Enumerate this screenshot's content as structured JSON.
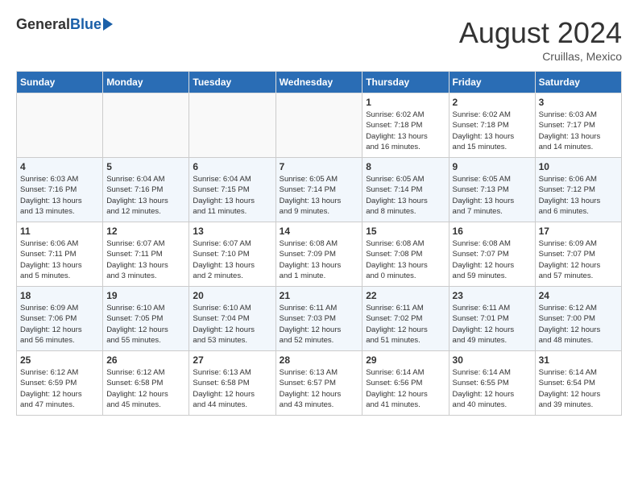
{
  "header": {
    "logo_general": "General",
    "logo_blue": "Blue",
    "month_year": "August 2024",
    "location": "Cruillas, Mexico"
  },
  "days_of_week": [
    "Sunday",
    "Monday",
    "Tuesday",
    "Wednesday",
    "Thursday",
    "Friday",
    "Saturday"
  ],
  "weeks": [
    [
      {
        "day": "",
        "info": ""
      },
      {
        "day": "",
        "info": ""
      },
      {
        "day": "",
        "info": ""
      },
      {
        "day": "",
        "info": ""
      },
      {
        "day": "1",
        "info": "Sunrise: 6:02 AM\nSunset: 7:18 PM\nDaylight: 13 hours\nand 16 minutes."
      },
      {
        "day": "2",
        "info": "Sunrise: 6:02 AM\nSunset: 7:18 PM\nDaylight: 13 hours\nand 15 minutes."
      },
      {
        "day": "3",
        "info": "Sunrise: 6:03 AM\nSunset: 7:17 PM\nDaylight: 13 hours\nand 14 minutes."
      }
    ],
    [
      {
        "day": "4",
        "info": "Sunrise: 6:03 AM\nSunset: 7:16 PM\nDaylight: 13 hours\nand 13 minutes."
      },
      {
        "day": "5",
        "info": "Sunrise: 6:04 AM\nSunset: 7:16 PM\nDaylight: 13 hours\nand 12 minutes."
      },
      {
        "day": "6",
        "info": "Sunrise: 6:04 AM\nSunset: 7:15 PM\nDaylight: 13 hours\nand 11 minutes."
      },
      {
        "day": "7",
        "info": "Sunrise: 6:05 AM\nSunset: 7:14 PM\nDaylight: 13 hours\nand 9 minutes."
      },
      {
        "day": "8",
        "info": "Sunrise: 6:05 AM\nSunset: 7:14 PM\nDaylight: 13 hours\nand 8 minutes."
      },
      {
        "day": "9",
        "info": "Sunrise: 6:05 AM\nSunset: 7:13 PM\nDaylight: 13 hours\nand 7 minutes."
      },
      {
        "day": "10",
        "info": "Sunrise: 6:06 AM\nSunset: 7:12 PM\nDaylight: 13 hours\nand 6 minutes."
      }
    ],
    [
      {
        "day": "11",
        "info": "Sunrise: 6:06 AM\nSunset: 7:11 PM\nDaylight: 13 hours\nand 5 minutes."
      },
      {
        "day": "12",
        "info": "Sunrise: 6:07 AM\nSunset: 7:11 PM\nDaylight: 13 hours\nand 3 minutes."
      },
      {
        "day": "13",
        "info": "Sunrise: 6:07 AM\nSunset: 7:10 PM\nDaylight: 13 hours\nand 2 minutes."
      },
      {
        "day": "14",
        "info": "Sunrise: 6:08 AM\nSunset: 7:09 PM\nDaylight: 13 hours\nand 1 minute."
      },
      {
        "day": "15",
        "info": "Sunrise: 6:08 AM\nSunset: 7:08 PM\nDaylight: 13 hours\nand 0 minutes."
      },
      {
        "day": "16",
        "info": "Sunrise: 6:08 AM\nSunset: 7:07 PM\nDaylight: 12 hours\nand 59 minutes."
      },
      {
        "day": "17",
        "info": "Sunrise: 6:09 AM\nSunset: 7:07 PM\nDaylight: 12 hours\nand 57 minutes."
      }
    ],
    [
      {
        "day": "18",
        "info": "Sunrise: 6:09 AM\nSunset: 7:06 PM\nDaylight: 12 hours\nand 56 minutes."
      },
      {
        "day": "19",
        "info": "Sunrise: 6:10 AM\nSunset: 7:05 PM\nDaylight: 12 hours\nand 55 minutes."
      },
      {
        "day": "20",
        "info": "Sunrise: 6:10 AM\nSunset: 7:04 PM\nDaylight: 12 hours\nand 53 minutes."
      },
      {
        "day": "21",
        "info": "Sunrise: 6:11 AM\nSunset: 7:03 PM\nDaylight: 12 hours\nand 52 minutes."
      },
      {
        "day": "22",
        "info": "Sunrise: 6:11 AM\nSunset: 7:02 PM\nDaylight: 12 hours\nand 51 minutes."
      },
      {
        "day": "23",
        "info": "Sunrise: 6:11 AM\nSunset: 7:01 PM\nDaylight: 12 hours\nand 49 minutes."
      },
      {
        "day": "24",
        "info": "Sunrise: 6:12 AM\nSunset: 7:00 PM\nDaylight: 12 hours\nand 48 minutes."
      }
    ],
    [
      {
        "day": "25",
        "info": "Sunrise: 6:12 AM\nSunset: 6:59 PM\nDaylight: 12 hours\nand 47 minutes."
      },
      {
        "day": "26",
        "info": "Sunrise: 6:12 AM\nSunset: 6:58 PM\nDaylight: 12 hours\nand 45 minutes."
      },
      {
        "day": "27",
        "info": "Sunrise: 6:13 AM\nSunset: 6:58 PM\nDaylight: 12 hours\nand 44 minutes."
      },
      {
        "day": "28",
        "info": "Sunrise: 6:13 AM\nSunset: 6:57 PM\nDaylight: 12 hours\nand 43 minutes."
      },
      {
        "day": "29",
        "info": "Sunrise: 6:14 AM\nSunset: 6:56 PM\nDaylight: 12 hours\nand 41 minutes."
      },
      {
        "day": "30",
        "info": "Sunrise: 6:14 AM\nSunset: 6:55 PM\nDaylight: 12 hours\nand 40 minutes."
      },
      {
        "day": "31",
        "info": "Sunrise: 6:14 AM\nSunset: 6:54 PM\nDaylight: 12 hours\nand 39 minutes."
      }
    ]
  ]
}
